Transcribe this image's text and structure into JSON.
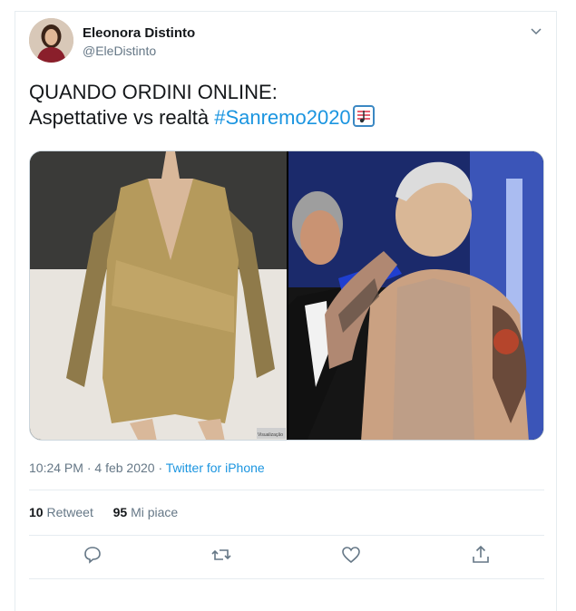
{
  "tweet": {
    "author_name": "Eleonora Distinto",
    "author_handle": "@EleDistinto",
    "line1": "QUANDO ORDINI ONLINE:",
    "line2_prefix": "Aspettative vs realtà ",
    "hashtag": "#Sanremo2020",
    "image_caption": "Visualização",
    "time": "10:24 PM",
    "sep1": " · ",
    "date": "4 feb 2020",
    "sep2": " · ",
    "source": "Twitter for iPhone",
    "retweet_count": "10",
    "retweet_label": "Retweet",
    "like_count": "95",
    "like_label": "Mi piace"
  },
  "icons": {
    "menu": "chevron-down-icon",
    "reply": "reply-icon",
    "retweet": "retweet-icon",
    "like": "heart-icon",
    "share": "share-icon",
    "emoji": "music-score-emoji"
  },
  "colors": {
    "link": "#1b95e0",
    "secondary_text": "#657786",
    "primary_text": "#14171a",
    "border": "#e6ecf0"
  }
}
